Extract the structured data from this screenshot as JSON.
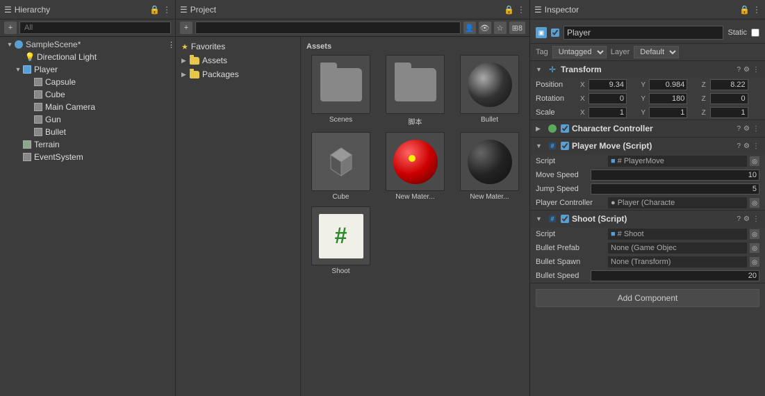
{
  "hierarchy": {
    "title": "Hierarchy",
    "search_placeholder": "All",
    "scene": "SampleScene*",
    "items": [
      {
        "label": "Directional Light",
        "indent": 1,
        "type": "light"
      },
      {
        "label": "Player",
        "indent": 1,
        "type": "player",
        "expanded": true
      },
      {
        "label": "Capsule",
        "indent": 2,
        "type": "cube"
      },
      {
        "label": "Cube",
        "indent": 2,
        "type": "cube"
      },
      {
        "label": "Main Camera",
        "indent": 2,
        "type": "cube"
      },
      {
        "label": "Gun",
        "indent": 2,
        "type": "cube"
      },
      {
        "label": "Bullet",
        "indent": 2,
        "type": "cube"
      },
      {
        "label": "Terrain",
        "indent": 1,
        "type": "terrain"
      },
      {
        "label": "EventSystem",
        "indent": 1,
        "type": "eventsystem"
      }
    ]
  },
  "project": {
    "title": "Project",
    "search_placeholder": "",
    "folders": [
      {
        "label": "Favorites",
        "type": "favorites"
      },
      {
        "label": "Assets",
        "type": "folder"
      },
      {
        "label": "Packages",
        "type": "folder"
      }
    ],
    "assets_title": "Assets",
    "assets": [
      {
        "label": "Scenes",
        "type": "folder"
      },
      {
        "label": "脚本",
        "type": "folder"
      },
      {
        "label": "Bullet",
        "type": "sphere"
      },
      {
        "label": "Cube",
        "type": "cube3d"
      },
      {
        "label": "New Mater...",
        "type": "red_sphere"
      },
      {
        "label": "New Mater...",
        "type": "dark_sphere"
      },
      {
        "label": "Shoot",
        "type": "hash"
      }
    ]
  },
  "inspector": {
    "title": "Inspector",
    "object_name": "Player",
    "tag": "Untagged",
    "layer": "Default",
    "static_label": "Static",
    "transform": {
      "title": "Transform",
      "position": {
        "x": "9.34",
        "y": "0.984",
        "z": "8.22"
      },
      "rotation": {
        "x": "0",
        "y": "180",
        "z": "0"
      },
      "scale": {
        "x": "1",
        "y": "1",
        "z": "1"
      }
    },
    "character_controller": {
      "title": "Character Controller"
    },
    "player_move": {
      "title": "Player Move (Script)",
      "script": "# PlayerMove",
      "move_speed_label": "Move Speed",
      "move_speed_value": "10",
      "jump_speed_label": "Jump Speed",
      "jump_speed_value": "5",
      "player_controller_label": "Player Controller",
      "player_controller_value": "● Player (Characte"
    },
    "shoot": {
      "title": "Shoot (Script)",
      "script": "# Shoot",
      "bullet_prefab_label": "Bullet Prefab",
      "bullet_prefab_value": "None (Game Objec",
      "bullet_spawn_label": "Bullet Spawn",
      "bullet_spawn_value": "None (Transform)",
      "bullet_speed_label": "Bullet Speed",
      "bullet_speed_value": "20"
    },
    "add_component": "Add Component"
  }
}
